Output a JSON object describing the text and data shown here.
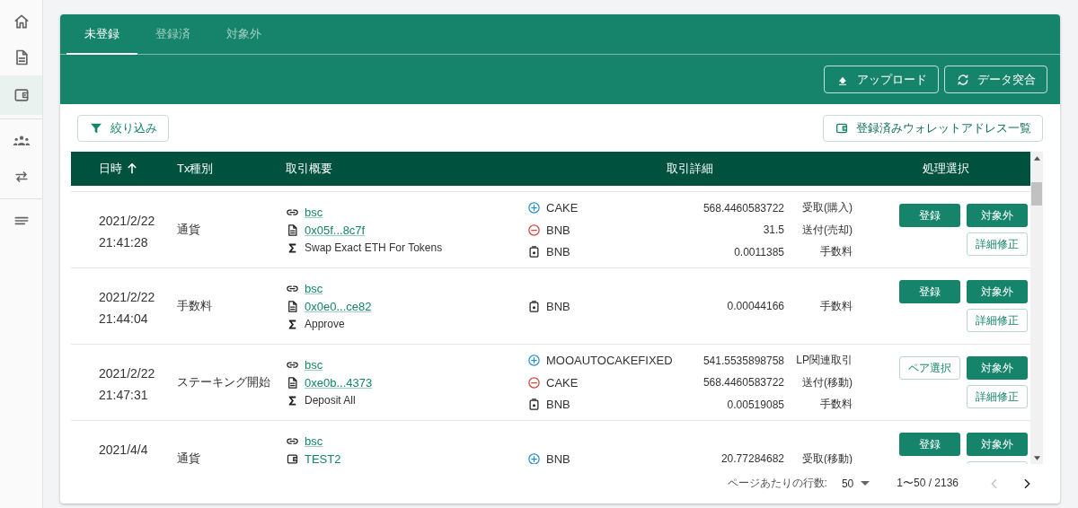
{
  "sidebar": {
    "groups": [
      [
        {
          "selected": false
        },
        {
          "selected": false
        },
        {
          "selected": true
        }
      ],
      [
        {
          "selected": false
        },
        {
          "selected": false
        }
      ],
      [
        {
          "selected": false
        }
      ]
    ]
  },
  "tabs": [
    {
      "label": "未登録",
      "selected": true
    },
    {
      "label": "登録済",
      "selected": false
    },
    {
      "label": "対象外",
      "selected": false
    }
  ],
  "toolbar": {
    "buttons": [
      {
        "kind": "upload",
        "label": "アップロード"
      },
      {
        "kind": "sync",
        "label": "データ突合"
      }
    ]
  },
  "filter_button": "絞り込み",
  "wallet_list_button": "登録済みウォレットアドレス一覧",
  "table": {
    "columns": [
      {
        "label": "日時",
        "sorted": true
      },
      {
        "label": "Tx種別",
        "sorted": false
      },
      {
        "label": "取引概要",
        "sorted": false
      },
      {
        "label": "取引詳細",
        "sorted": false
      },
      {
        "label": "処理選択",
        "sorted": false
      }
    ],
    "rows": [
      {
        "date": "2021/2/22",
        "time": "21:41:28",
        "type": "通貨",
        "summary": [
          {
            "kind": "chain",
            "text": "bsc"
          },
          {
            "kind": "tx",
            "text": "0x05f...8c7f"
          },
          {
            "kind": "method",
            "text": "Swap Exact ETH For Tokens"
          }
        ],
        "details": [
          {
            "kind": "in",
            "token": "CAKE",
            "amount": "568.4460583722",
            "category": "受取(購入)"
          },
          {
            "kind": "out",
            "token": "BNB",
            "amount": "31.5",
            "category": "送付(売却)"
          },
          {
            "kind": "fee",
            "token": "BNB",
            "amount": "0.0011385",
            "category": "手数料"
          }
        ],
        "actions": [
          {
            "kind": "filled",
            "label": "登録"
          },
          {
            "kind": "filled",
            "label": "対象外"
          },
          {
            "kind": "outlined",
            "label": "詳細修正"
          }
        ]
      },
      {
        "date": "2021/2/22",
        "time": "21:44:04",
        "type": "手数料",
        "summary": [
          {
            "kind": "chain",
            "text": "bsc"
          },
          {
            "kind": "tx",
            "text": "0x0e0...ce82"
          },
          {
            "kind": "method",
            "text": "Approve"
          }
        ],
        "details": [
          {
            "kind": "fee",
            "token": "BNB",
            "amount": "0.00044166",
            "category": "手数料"
          }
        ],
        "actions": [
          {
            "kind": "filled",
            "label": "登録"
          },
          {
            "kind": "filled",
            "label": "対象外"
          },
          {
            "kind": "outlined",
            "label": "詳細修正"
          }
        ]
      },
      {
        "date": "2021/2/22",
        "time": "21:47:31",
        "type": "ステーキング開始",
        "summary": [
          {
            "kind": "chain",
            "text": "bsc"
          },
          {
            "kind": "tx",
            "text": "0xe0b...4373"
          },
          {
            "kind": "method",
            "text": "Deposit All"
          }
        ],
        "details": [
          {
            "kind": "in",
            "token": "MOOAUTOCAKEFIXED",
            "amount": "541.5535898758",
            "category": "LP関連取引"
          },
          {
            "kind": "out",
            "token": "CAKE",
            "amount": "568.4460583722",
            "category": "送付(移動)"
          },
          {
            "kind": "fee",
            "token": "BNB",
            "amount": "0.00519085",
            "category": "手数料"
          }
        ],
        "actions": [
          {
            "kind": "outlined",
            "label": "ペア選択"
          },
          {
            "kind": "filled",
            "label": "対象外"
          },
          {
            "kind": "outlined",
            "label": "詳細修正"
          }
        ]
      },
      {
        "date": "2021/4/4",
        "type": "通貨",
        "summary": [
          {
            "kind": "chain",
            "text": "bsc"
          },
          {
            "kind": "wallet",
            "text": "TEST2"
          }
        ],
        "details": [
          {
            "kind": "in",
            "token": "BNB",
            "amount": "20.77284682",
            "category": "受取(移動)"
          }
        ],
        "actions": [
          {
            "kind": "filled",
            "label": "登録"
          },
          {
            "kind": "filled",
            "label": "対象外"
          },
          {
            "kind": "outlined"
          }
        ]
      }
    ]
  },
  "pagination": {
    "rows_label": "ページあたりの行数:",
    "rows_per_page": "50",
    "range": "1〜50 / 2136",
    "prev_disabled": true,
    "next_disabled": false
  }
}
